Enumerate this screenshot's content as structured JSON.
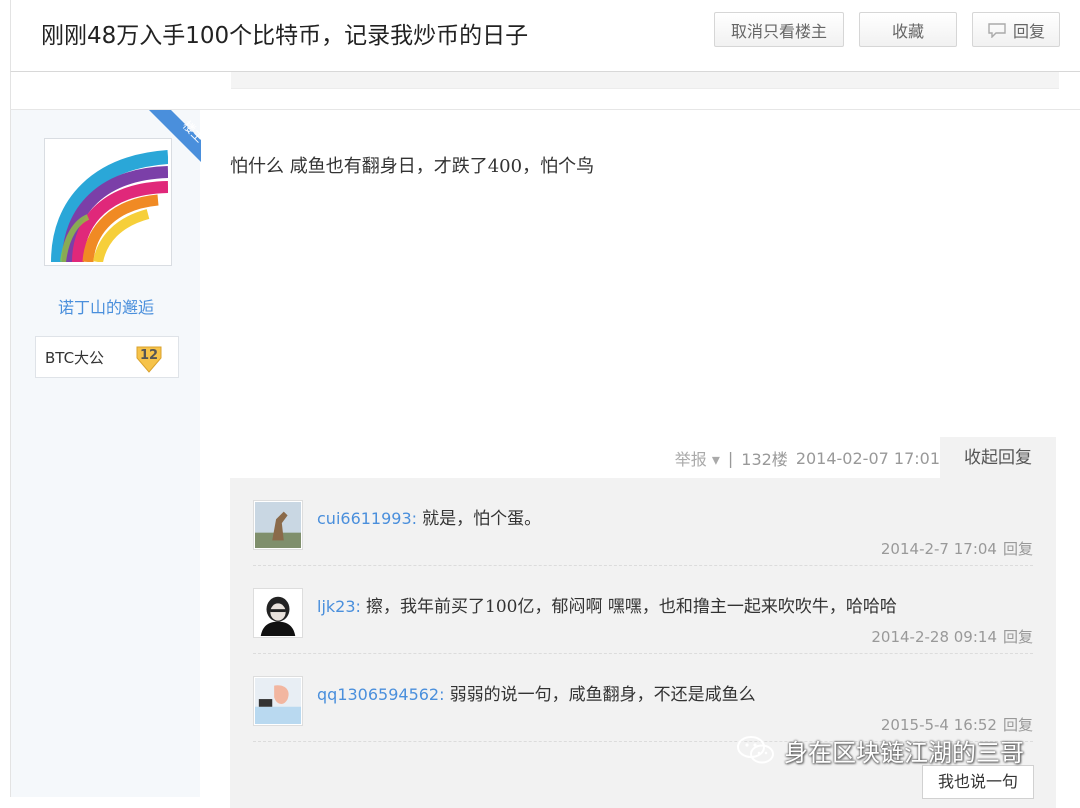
{
  "header": {
    "title": "刚刚48万入手100个比特币，记录我炒币的日子",
    "cancel_owner_only": "取消只看楼主",
    "favorite": "收藏",
    "reply": "回复"
  },
  "author": {
    "badge": "楼主",
    "name": "诺丁山的邂逅",
    "level_name": "BTC大公",
    "level": "12"
  },
  "post": {
    "content": "怕什么 咸鱼也有翻身日，才跌了400，怕个鸟",
    "report": "举报",
    "floor": "132楼",
    "datetime": "2014-02-07 17:01",
    "collapse_reply": "收起回复"
  },
  "replies": [
    {
      "user": "cui6611993",
      "text": "就是，怕个蛋。",
      "time": "2014-2-7 17:04",
      "reply": "回复"
    },
    {
      "user": "ljk23",
      "text": "擦，我年前买了100亿，郁闷啊 嘿嘿，也和撸主一起来吹吹牛，哈哈哈",
      "time": "2014-2-28 09:14",
      "reply": "回复"
    },
    {
      "user": "qq1306594562",
      "text": "弱弱的说一句，咸鱼翻身，不还是咸鱼么",
      "time": "2015-5-4 16:52",
      "reply": "回复"
    }
  ],
  "reply_button": "我也说一句",
  "watermark": "身在区块链江湖的三哥",
  "colors": {
    "link": "#4a8fdc",
    "badge": "#4a8fdc",
    "panel": "#f2f2f2"
  }
}
